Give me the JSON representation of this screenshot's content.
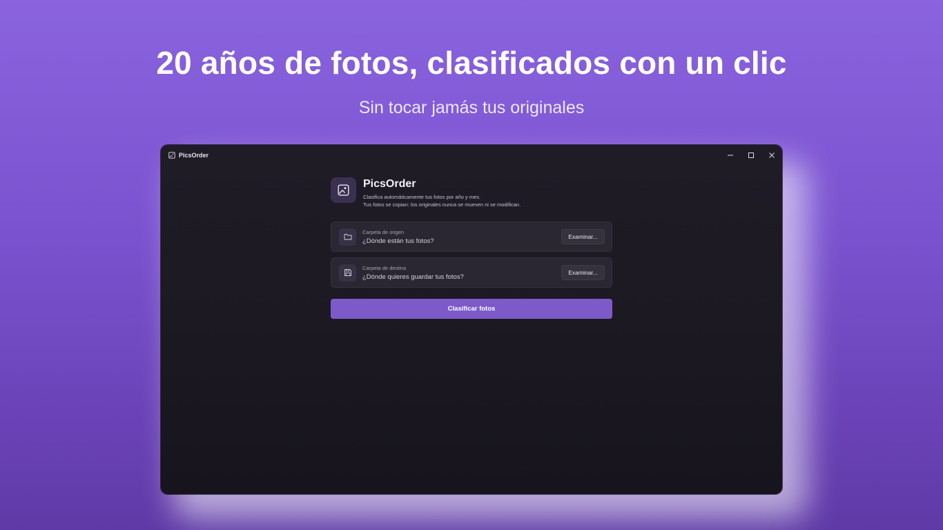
{
  "hero": {
    "title": "20 años de fotos, clasificados con un clic",
    "subtitle": "Sin tocar jamás tus originales"
  },
  "window": {
    "title": "PicsOrder",
    "icon": "image-icon",
    "controls": [
      "minimize-icon",
      "maximize-icon",
      "close-icon"
    ]
  },
  "app": {
    "title": "PicsOrder",
    "desc_line1": "Clasifica automáticamente tus fotos por año y mes.",
    "desc_line2": "Tus fotos se copian: los originales nunca se mueven ni se modifican."
  },
  "source": {
    "label": "Carpeta de origen",
    "value": "¿Dónde están tus fotos?",
    "button": "Examinar...",
    "icon": "folder-icon"
  },
  "destination": {
    "label": "Carpeta de destino",
    "value": "¿Dónde quieres guardar tus fotos?",
    "button": "Examinar...",
    "icon": "save-icon"
  },
  "action": {
    "label": "Clasificar fotos"
  },
  "colors": {
    "background": "#8a63df",
    "window_bg": "#1c1922",
    "accent": "#7d5ac9"
  }
}
